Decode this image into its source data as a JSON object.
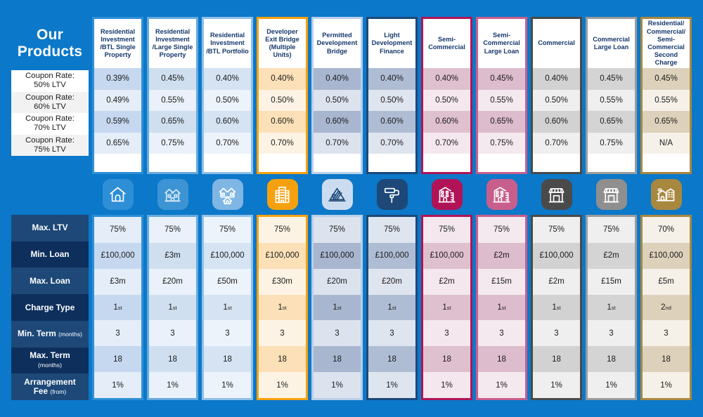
{
  "title": "Our Products",
  "coupon_row_labels": [
    "Coupon Rate: 50% LTV",
    "Coupon Rate: 60% LTV",
    "Coupon Rate: 70% LTV",
    "Coupon Rate: 75% LTV"
  ],
  "spec_row_labels": [
    {
      "main": "Max. LTV",
      "sub": ""
    },
    {
      "main": "Min. Loan",
      "sub": ""
    },
    {
      "main": "Max. Loan",
      "sub": ""
    },
    {
      "main": "Charge Type",
      "sub": ""
    },
    {
      "main": "Min. Term",
      "sub": "(months)"
    },
    {
      "main": "Max. Term",
      "sub": "(months)"
    },
    {
      "main": "Arrangement Fee",
      "sub": "(from)"
    }
  ],
  "columns": [
    {
      "name": "Residential Investment /BTL Single Property",
      "icon": "house-icon",
      "border": "#2e8fd6",
      "badge": "#2e8fd6",
      "icon_stroke": "#ffffff",
      "shade_a": "#c6d8ef",
      "shade_b": "#e5edf8",
      "coupon": [
        "0.39%",
        "0.49%",
        "0.59%",
        "0.65%"
      ],
      "specs": [
        "75%",
        "£100,000",
        "£3m",
        "1st",
        "3",
        "18",
        "1%"
      ]
    },
    {
      "name": "Residential Investment /Large Single Property",
      "icon": "duplex-icon",
      "border": "#67a9df",
      "badge": "#3d94d4",
      "icon_stroke": "#d9eaf7",
      "shade_a": "#cfdff0",
      "shade_b": "#eaf1fa",
      "coupon": [
        "0.45%",
        "0.55%",
        "0.65%",
        "0.75%"
      ],
      "specs": [
        "75%",
        "£3m",
        "£20m",
        "1st",
        "3",
        "18",
        "1%"
      ]
    },
    {
      "name": "Residential Investment /BTL Portfolio",
      "icon": "twin-house-icon",
      "border": "#8fc0e8",
      "badge": "#7fb6e4",
      "icon_stroke": "#ffffff",
      "shade_a": "#d5e3f3",
      "shade_b": "#edf3fb",
      "coupon": [
        "0.40%",
        "0.50%",
        "0.60%",
        "0.70%"
      ],
      "specs": [
        "75%",
        "£100,000",
        "£50m",
        "1st",
        "3",
        "18",
        "1%"
      ]
    },
    {
      "name": "Developer Exit Bridge (Multiple Units)",
      "icon": "apartment-block-icon",
      "border": "#f5a10f",
      "badge": "#f5a10f",
      "icon_stroke": "#ffffff",
      "shade_a": "#fbe0b8",
      "shade_b": "#fdf3e4",
      "coupon": [
        "0.40%",
        "0.50%",
        "0.60%",
        "0.70%"
      ],
      "specs": [
        "75%",
        "£100,000",
        "£30m",
        "1st",
        "3",
        "18",
        "1%"
      ]
    },
    {
      "name": "Permitted Development Bridge",
      "icon": "conversion-plans-icon",
      "border": "#b9cfe9",
      "badge": "#ccdcf0",
      "icon_stroke": "#1d4878",
      "shade_a": "#a8b6cf",
      "shade_b": "#dde3ee",
      "coupon": [
        "0.40%",
        "0.50%",
        "0.60%",
        "0.70%"
      ],
      "specs": [
        "75%",
        "£100,000",
        "£20m",
        "1st",
        "3",
        "18",
        "1%"
      ]
    },
    {
      "name": "Light Development Finance",
      "icon": "paint-roller-icon",
      "border": "#1d4878",
      "badge": "#1d4878",
      "icon_stroke": "#ffffff",
      "shade_a": "#afbdd4",
      "shade_b": "#dfe5ef",
      "coupon": [
        "0.40%",
        "0.50%",
        "0.60%",
        "0.70%"
      ],
      "specs": [
        "75%",
        "£100,000",
        "£20m",
        "1st",
        "3",
        "18",
        "1%"
      ]
    },
    {
      "name": "Semi-Commercial",
      "icon": "semi-commercial-building-icon",
      "border": "#b01457",
      "badge": "#b01457",
      "icon_stroke": "#ffffff",
      "shade_a": "#dfc0cf",
      "shade_b": "#f4e8ee",
      "coupon": [
        "0.40%",
        "0.50%",
        "0.60%",
        "0.70%"
      ],
      "specs": [
        "75%",
        "£100,000",
        "£2m",
        "1st",
        "3",
        "18",
        "1%"
      ]
    },
    {
      "name": "Semi-Commercial Large Loan",
      "icon": "semi-commercial-building-icon",
      "border": "#c85e8c",
      "badge": "#c85e8c",
      "icon_stroke": "#ffffff",
      "shade_a": "#dcbccd",
      "shade_b": "#f4e9ef",
      "coupon": [
        "0.45%",
        "0.55%",
        "0.65%",
        "0.75%"
      ],
      "specs": [
        "75%",
        "£2m",
        "£15m",
        "1st",
        "3",
        "18",
        "1%"
      ]
    },
    {
      "name": "Commercial",
      "icon": "shop-icon",
      "border": "#4a4a4a",
      "badge": "#4a4a4a",
      "icon_stroke": "#ffffff",
      "shade_a": "#d2d2d2",
      "shade_b": "#efefef",
      "coupon": [
        "0.40%",
        "0.50%",
        "0.60%",
        "0.70%"
      ],
      "specs": [
        "75%",
        "£100,000",
        "£2m",
        "1st",
        "3",
        "18",
        "1%"
      ]
    },
    {
      "name": "Commercial Large Loan",
      "icon": "shop-icon",
      "border": "#9b9b9b",
      "badge": "#8f8f8f",
      "icon_stroke": "#ffffff",
      "shade_a": "#d4d4d4",
      "shade_b": "#efefef",
      "coupon": [
        "0.45%",
        "0.55%",
        "0.65%",
        "0.75%"
      ],
      "specs": [
        "75%",
        "£2m",
        "£15m",
        "1st",
        "3",
        "18",
        "1%"
      ]
    },
    {
      "name": "Residential/ Commercial/ Semi-Commercial Second Charge",
      "icon": "mixed-second-charge-icon",
      "border": "#a8883f",
      "badge": "#a8883f",
      "icon_stroke": "#ffffff",
      "shade_a": "#ddd1bb",
      "shade_b": "#f5f1e9",
      "coupon": [
        "0.45%",
        "0.55%",
        "0.65%",
        "N/A"
      ],
      "specs": [
        "70%",
        "£100,000",
        "£5m",
        "2nd",
        "3",
        "18",
        "1%"
      ]
    }
  ]
}
